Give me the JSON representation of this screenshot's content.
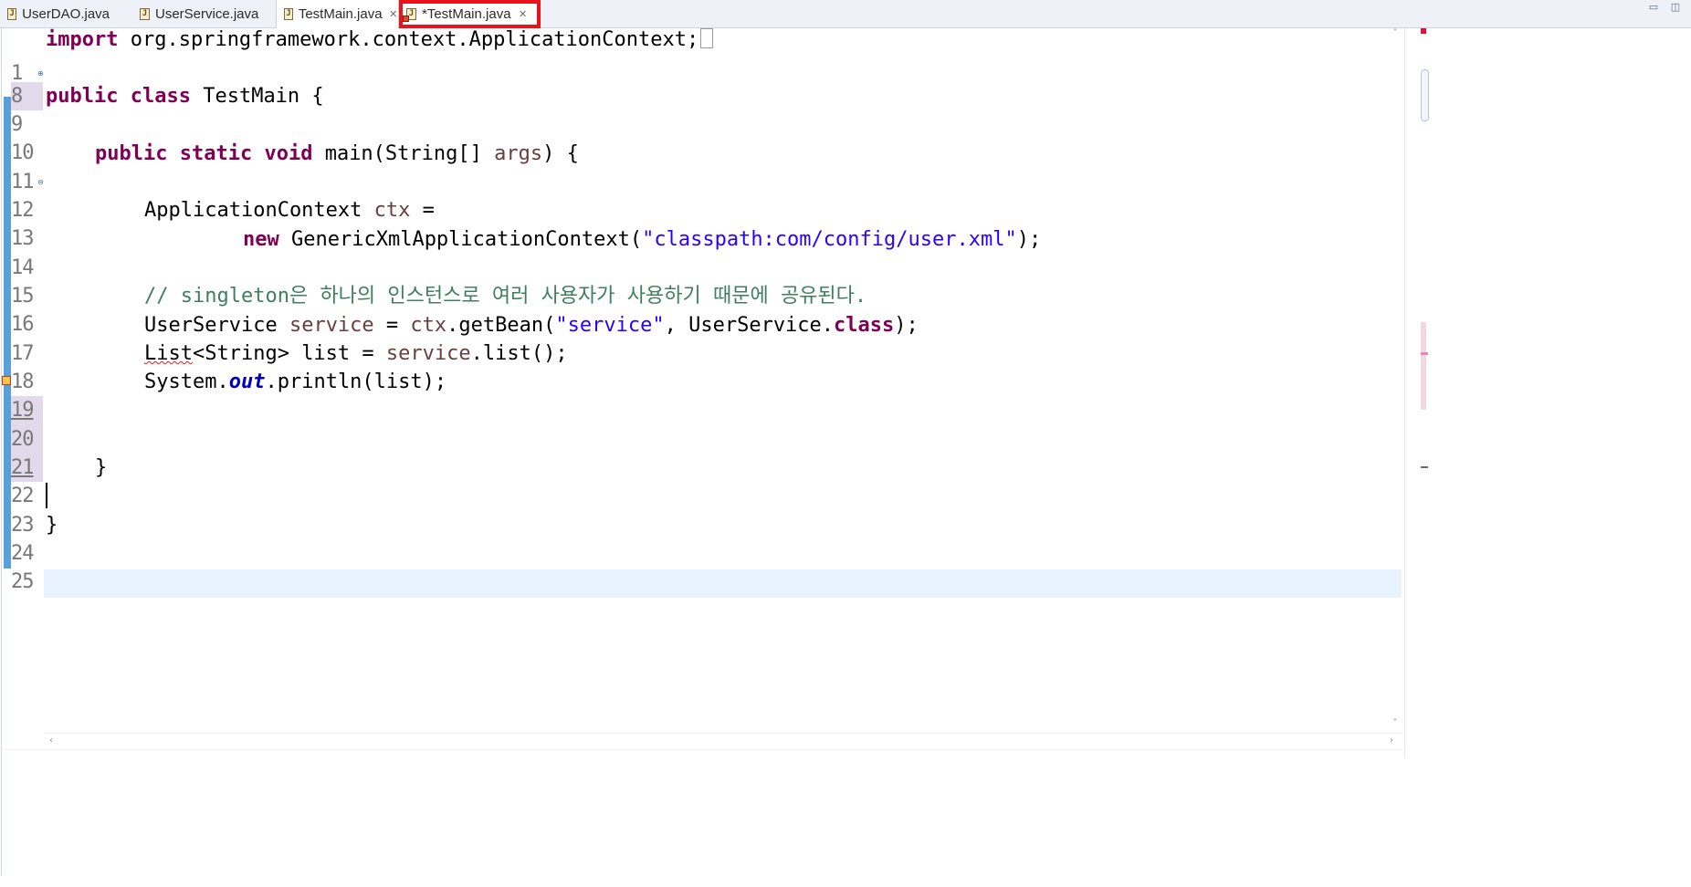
{
  "tabs": [
    {
      "label": "UserDAO.java",
      "icon": "java-file-icon",
      "active": false,
      "closable": false
    },
    {
      "label": "UserService.java",
      "icon": "java-file-icon",
      "active": false,
      "closable": false
    },
    {
      "label": "TestMain.java",
      "icon": "java-file-icon",
      "active": true,
      "closable": true
    },
    {
      "label": "*TestMain.java",
      "icon": "java-file-error-icon",
      "active": false,
      "closable": true,
      "highlighted": true,
      "highlight_color": "#e8141b"
    }
  ],
  "window_controls": {
    "minimize_icon": "minimize-icon",
    "maximize_icon": "maximize-icon"
  },
  "editor": {
    "line_numbers": [
      "1",
      "8",
      "9",
      "10",
      "11",
      "12",
      "13",
      "14",
      "15",
      "16",
      "17",
      "18",
      "19",
      "20",
      "21",
      "22",
      "23",
      "24",
      "25"
    ],
    "current_line": "23",
    "code": {
      "l1_kw": "import",
      "l1_rest": " org.springframework.context.ApplicationContext;",
      "l9_kw1": "public",
      "l9_kw2": "class",
      "l9_rest": " TestMain {",
      "l11_kw1": "public",
      "l11_kw2": "static",
      "l11_kw3": "void",
      "l11_rest1": " main(String[] ",
      "l11_param": "args",
      "l11_rest2": ") {",
      "l13_type": "ApplicationContext ",
      "l13_var": "ctx",
      "l13_rest": " =",
      "l14_kw": "new",
      "l14_rest1": " GenericXmlApplicationContext(",
      "l14_str": "\"classpath:com/config/user.xml\"",
      "l14_rest2": ");",
      "l16_comment": "// singleton은 하나의 인스턴스로 여러 사용자가 사용하기 때문에 공유된다.",
      "l17_type": "UserService ",
      "l17_var": "service",
      "l17_eq": " = ",
      "l17_ctx": "ctx",
      "l17_rest1": ".getBean(",
      "l17_str": "\"service\"",
      "l17_rest2": ", UserService.",
      "l17_kw": "class",
      "l17_rest3": ");",
      "l18_err": "List",
      "l18_rest1": "<String> list = ",
      "l18_var": "service",
      "l18_rest2": ".list();",
      "l19_rest1": "System.",
      "l19_field": "out",
      "l19_rest2": ".println(list);",
      "l22_brace": "}",
      "l24_brace": "}"
    }
  },
  "colors": {
    "keyword": "#7f0055",
    "string": "#2a00ff",
    "comment": "#3f7f5f",
    "static_field": "#0000c0",
    "local_variable": "#6a3e3e",
    "current_line_bg": "#e8f2fe",
    "change_bar": "#5aa0d8"
  }
}
